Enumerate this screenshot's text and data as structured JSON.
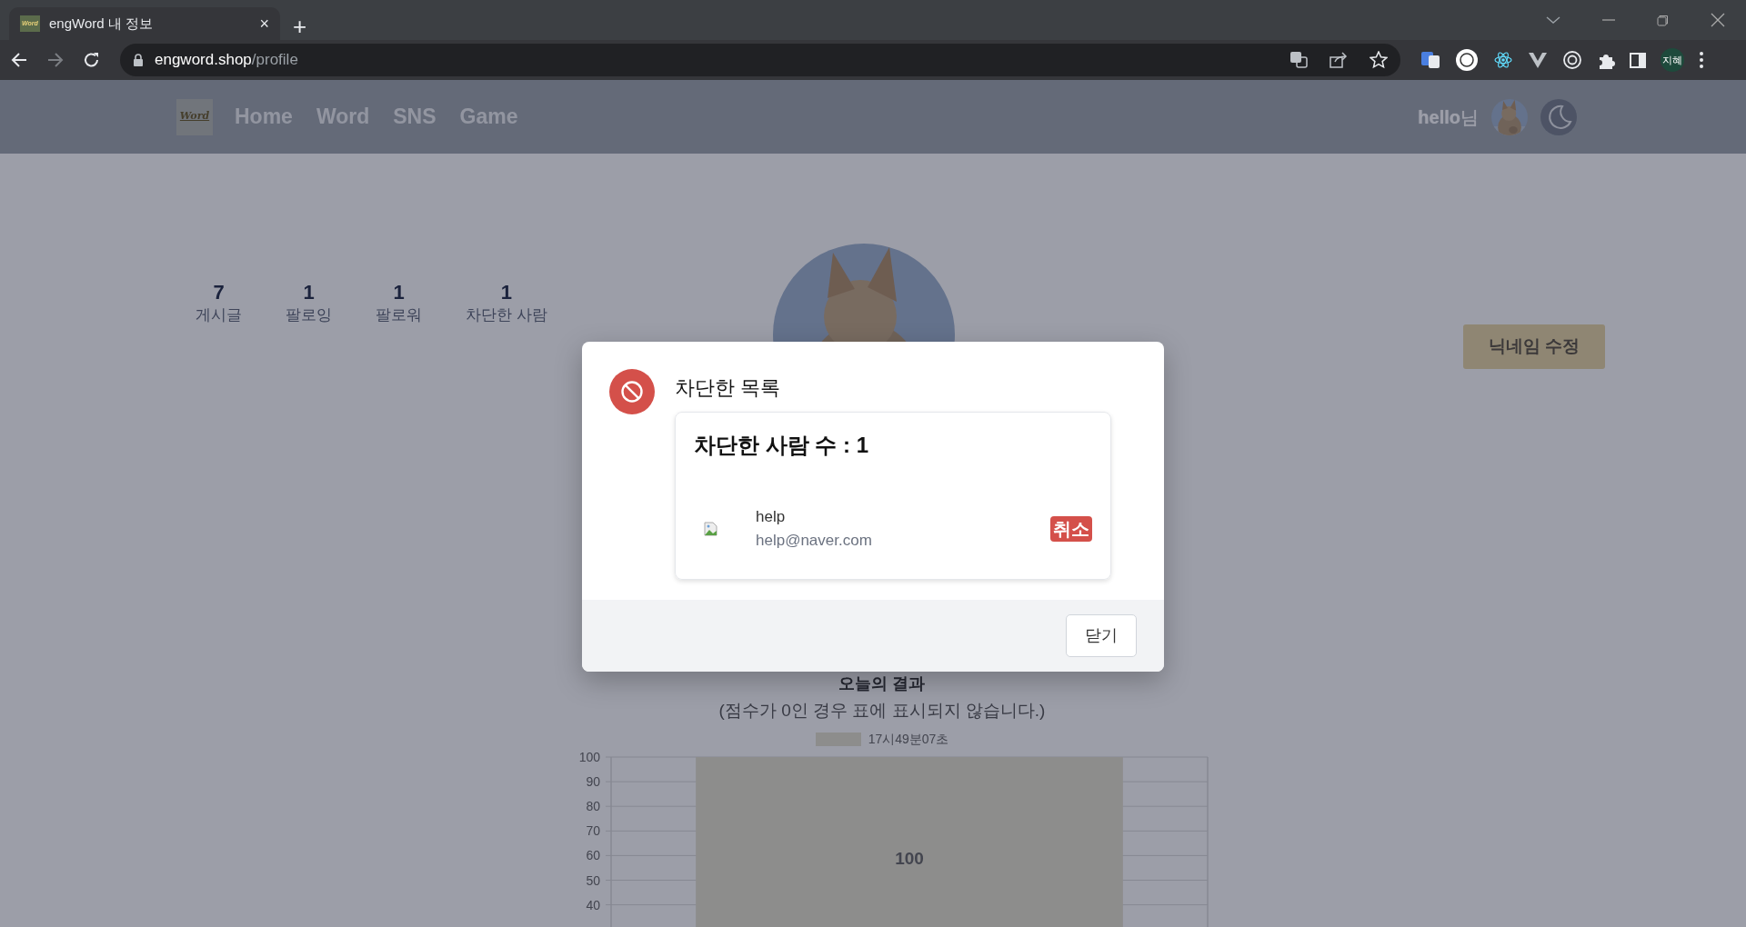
{
  "browser": {
    "tabs": [
      {
        "title": "engWord 내 정보",
        "favicon": "Word",
        "close": "×",
        "selected": true
      }
    ],
    "new_tab": "+",
    "url_host": "engword.shop",
    "url_path": "/profile",
    "forward_disabled": true,
    "profile_initials": "지혜"
  },
  "navbar": {
    "logo": "Word",
    "links": [
      "Home",
      "Word",
      "SNS",
      "Game"
    ],
    "greeting": "hello",
    "honorific": "님"
  },
  "profile": {
    "stats": [
      {
        "value": "7",
        "label": "게시글"
      },
      {
        "value": "1",
        "label": "팔로잉"
      },
      {
        "value": "1",
        "label": "팔로워"
      },
      {
        "value": "1",
        "label": "차단한 사람"
      }
    ],
    "edit_button": "닉네임 수정"
  },
  "results": {
    "title": "오늘의 결과",
    "subtitle": "(점수가 0인 경우 표에 표시되지 않습니다.)",
    "chart_data": {
      "type": "bar",
      "series": [
        {
          "name": "17시49분07초",
          "color": "#e6e2cf",
          "values": [
            100
          ]
        }
      ],
      "ylim": [
        0,
        100
      ],
      "grid": true,
      "yticks": [
        40,
        50,
        60,
        70,
        80,
        90,
        100
      ],
      "data_labels": true
    }
  },
  "modal": {
    "title": "차단한 목록",
    "heading": "차단한 사람 수 : 1",
    "users": [
      {
        "name": "help",
        "email": "help@naver.com",
        "action": "취소"
      }
    ],
    "close_button": "닫기"
  }
}
